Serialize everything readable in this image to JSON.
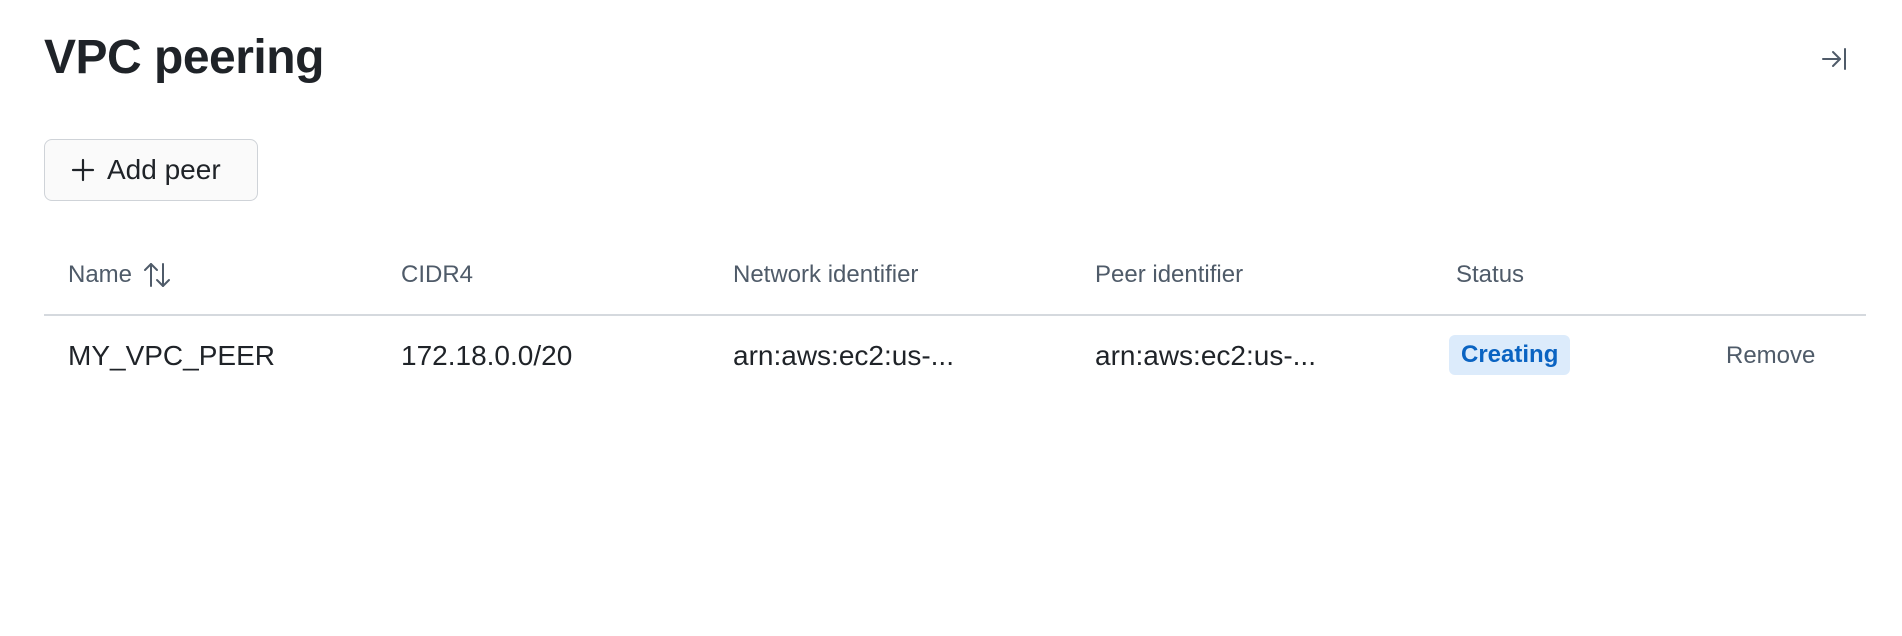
{
  "page": {
    "title": "VPC peering"
  },
  "toolbar": {
    "add_peer_label": "Add peer"
  },
  "table": {
    "columns": [
      {
        "label": "Name",
        "sortable": true
      },
      {
        "label": "CIDR4"
      },
      {
        "label": "Network identifier"
      },
      {
        "label": "Peer identifier"
      },
      {
        "label": "Status"
      }
    ],
    "rows": [
      {
        "name": "MY_VPC_PEER",
        "cidr4": "172.18.0.0/20",
        "network_identifier": "arn:aws:ec2:us-...",
        "peer_identifier": "arn:aws:ec2:us-...",
        "status": "Creating",
        "action": "Remove"
      }
    ]
  },
  "colors": {
    "status_creating_bg": "#dcebfb",
    "status_creating_text": "#0a63c2"
  },
  "icons": {
    "collapse": "collapse-panel-icon",
    "add": "plus-icon",
    "sort": "sort-icon"
  }
}
